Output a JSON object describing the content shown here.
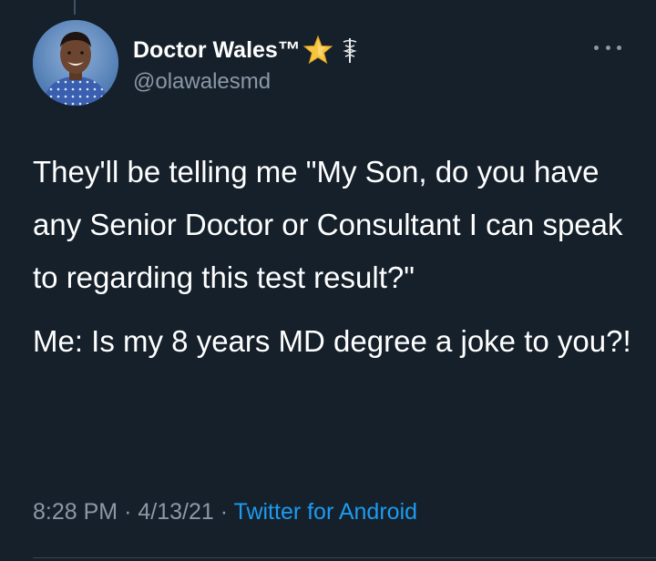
{
  "user": {
    "display_name": "Doctor Wales™",
    "handle": "@olawalesmd",
    "badges": [
      "star-icon",
      "caduceus-icon"
    ]
  },
  "tweet": {
    "paragraphs": [
      "They'll be telling me \"My Son, do you have any Senior Doctor or Consultant I can speak to regarding this test result?\"",
      "Me: Is my 8 years MD degree a joke to you?!"
    ],
    "time": "8:28 PM",
    "date": "4/13/21",
    "separator": "·",
    "source": "Twitter for Android"
  },
  "colors": {
    "background": "#15202b",
    "text": "#ffffff",
    "secondary": "#8b98a5",
    "accent": "#1d9bf0",
    "divider": "#38444d"
  },
  "icons": {
    "more": "more-horizontal-icon",
    "avatar": "avatar"
  }
}
